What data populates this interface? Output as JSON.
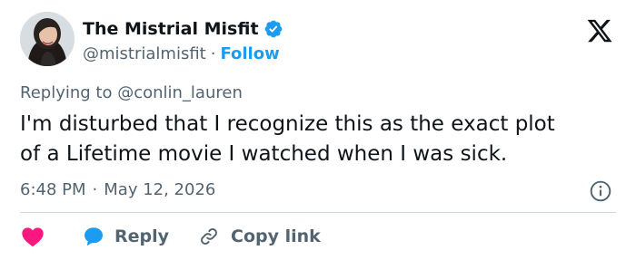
{
  "author": {
    "display_name": "The Mistrial Misfit",
    "handle": "@mistrialmisfit",
    "separator": "·",
    "follow_label": "Follow",
    "verified_icon": "verified-badge-icon"
  },
  "platform_logo": "x-logo-icon",
  "reply_context": "Replying to @conlin_lauren",
  "tweet": {
    "lines": [
      "I'm disturbed that I recognize this as the exact plot",
      "of a Lifetime movie I watched when I was sick."
    ]
  },
  "timestamp": {
    "time": "6:48 PM",
    "separator": "·",
    "date": "May 12, 2026"
  },
  "actions": {
    "like_icon": "heart-icon",
    "reply_label": "Reply",
    "reply_icon": "speech-bubble-icon",
    "copy_label": "Copy link",
    "copy_icon": "link-icon"
  },
  "colors": {
    "accent": "#1d9bf0",
    "like": "#f91880",
    "text": "#0f1419",
    "muted": "#536471",
    "divider": "#cfd9de"
  }
}
